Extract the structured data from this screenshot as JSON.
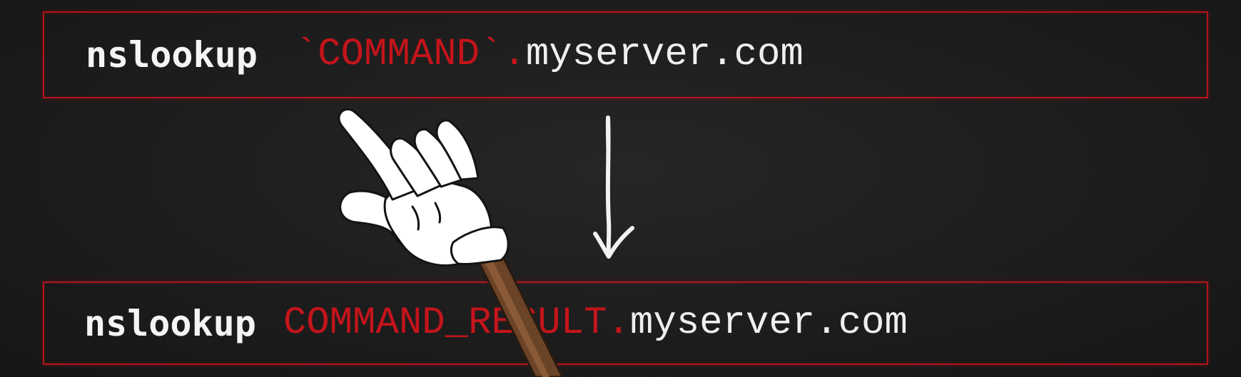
{
  "top_command": {
    "keyword": "nslookup",
    "injected": "`COMMAND`",
    "separator": ".",
    "domain": "myserver.com"
  },
  "bottom_command": {
    "keyword": "nslookup",
    "result": "COMMAND_RESULT",
    "separator": ".",
    "domain": "myserver.com"
  },
  "icons": {
    "pointer": "pointing-hand-icon",
    "arrow": "down-arrow-icon"
  },
  "colors": {
    "accent_red": "#c4141b",
    "border_red": "#b3141c",
    "text_white": "#f4f4f4",
    "background": "#1d1d1d"
  }
}
